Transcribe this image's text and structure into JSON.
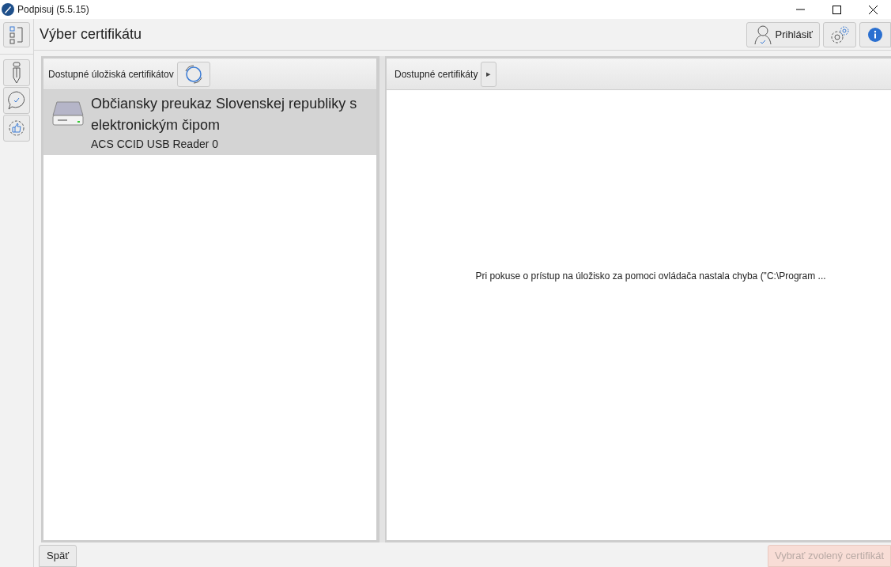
{
  "window": {
    "title": "Podpisuj (5.5.15)"
  },
  "page_title": "Výber certifikátu",
  "nav": [
    {
      "kind": "pencil",
      "selected": false
    },
    {
      "kind": "chat",
      "selected": false
    },
    {
      "kind": "badge",
      "selected": false
    }
  ],
  "login_button": {
    "label": "Prihlásiť"
  },
  "stores_panel": {
    "title": "Dostupné úložiská certifikátov",
    "items": [
      {
        "name": "Občiansky preukaz Slovenskej republiky s elektronickým čipom",
        "reader": "ACS CCID USB Reader 0",
        "selected": true
      }
    ]
  },
  "certificates_panel": {
    "title": "Dostupné certifikáty",
    "expand_glyph": "▸",
    "message": "Pri pokuse o prístup na úložisko za pomoci ovládača nastala chyba (\"C:\\Program ..."
  },
  "footer": {
    "back": {
      "label": "Späť",
      "disabled": false
    },
    "select": {
      "label": "Vybrať zvolený certifikát",
      "disabled": true
    }
  }
}
